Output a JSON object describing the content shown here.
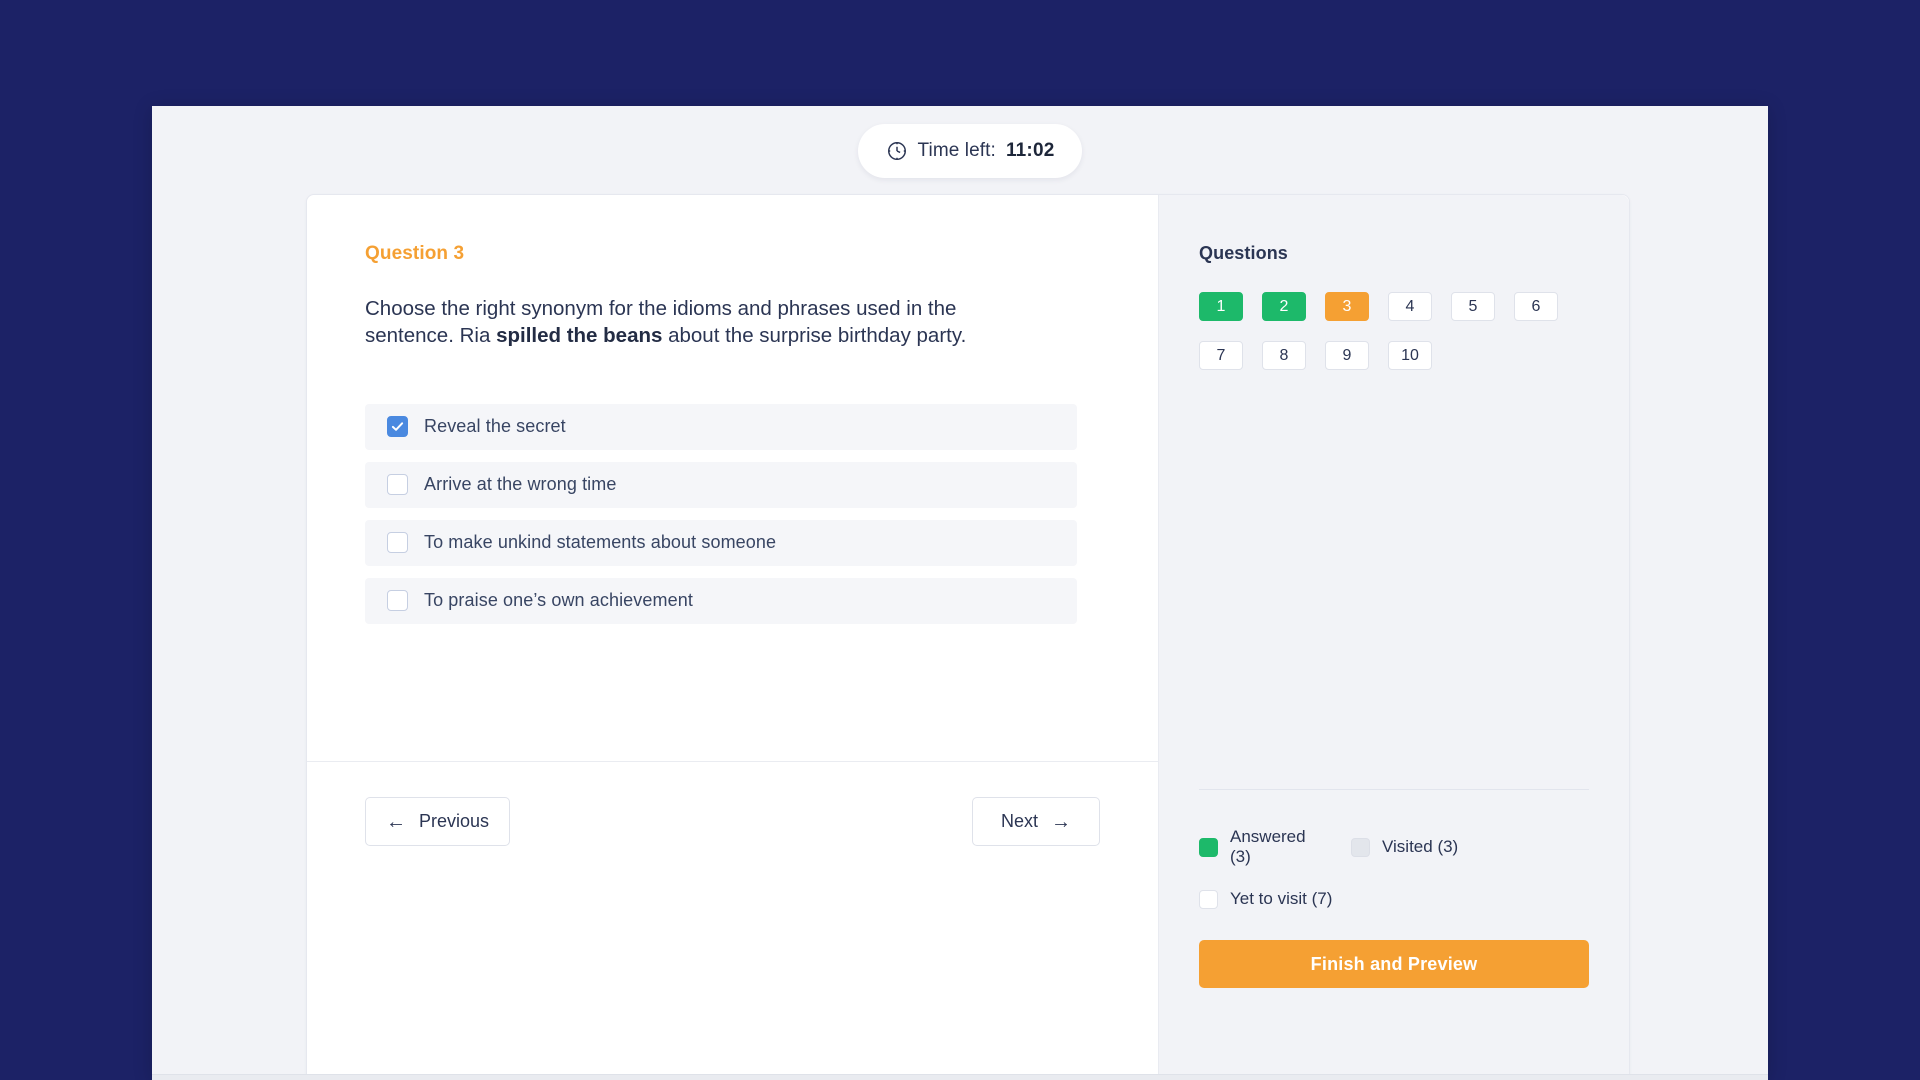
{
  "timer": {
    "icon": "clock-icon",
    "label": "Time left:",
    "value": "11:02"
  },
  "question": {
    "label": "Question 3",
    "prompt_line1": "Choose the right synonym for the idioms and phrases used in the sentence.",
    "prompt_prefix": "Ria ",
    "prompt_bold": "spilled the beans",
    "prompt_suffix": " about the surprise birthday party.",
    "options": [
      {
        "label": "Reveal the secret",
        "checked": true
      },
      {
        "label": "Arrive at the wrong time",
        "checked": false
      },
      {
        "label": "To make unkind statements about someone",
        "checked": false
      },
      {
        "label": "To praise one’s own achievement",
        "checked": false
      }
    ]
  },
  "navigation": {
    "previous_label": "Previous",
    "previous_icon": "arrow-left-icon",
    "next_label": "Next",
    "next_icon": "arrow-right-icon"
  },
  "sidebar": {
    "title": "Questions",
    "chips": [
      {
        "number": "1",
        "state": "answered"
      },
      {
        "number": "2",
        "state": "answered"
      },
      {
        "number": "3",
        "state": "current"
      },
      {
        "number": "4",
        "state": "unvisited"
      },
      {
        "number": "5",
        "state": "unvisited"
      },
      {
        "number": "6",
        "state": "unvisited"
      },
      {
        "number": "7",
        "state": "unvisited"
      },
      {
        "number": "8",
        "state": "unvisited"
      },
      {
        "number": "9",
        "state": "unvisited"
      },
      {
        "number": "10",
        "state": "unvisited"
      }
    ],
    "legend": [
      {
        "label": "Answered (3)",
        "swatch": "green"
      },
      {
        "label": "Visited (3)",
        "swatch": "gray"
      },
      {
        "label": "Yet to visit (7)",
        "swatch": "white"
      }
    ],
    "finish_label": "Finish and Preview"
  },
  "colors": {
    "background_navy": "#1c2266",
    "panel": "#f2f3f7",
    "accent_orange": "#f5a033",
    "answered_green": "#1db96a",
    "checkbox_blue": "#4a89e0",
    "text_dark": "#2b3553"
  }
}
